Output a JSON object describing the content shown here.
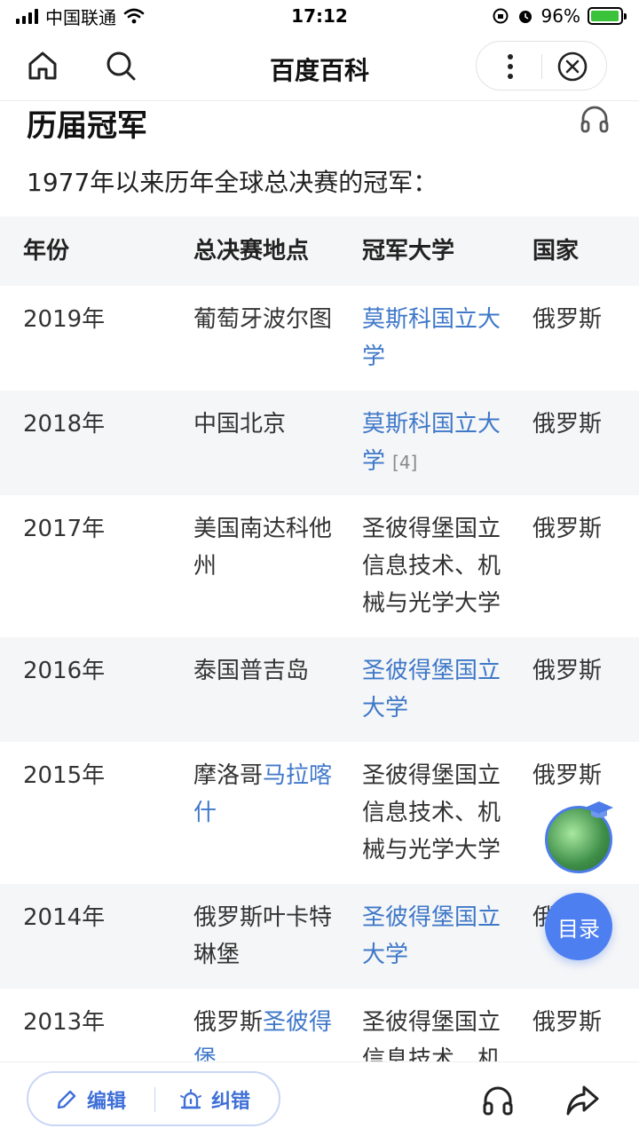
{
  "status_bar": {
    "carrier": "中国联通",
    "time": "17:12",
    "battery": "96%",
    "battery_level": 0.96
  },
  "nav": {
    "title": "百度百科"
  },
  "section": {
    "title": "历届冠军",
    "intro": "1977年以来历年全球总决赛的冠军："
  },
  "table": {
    "headers": [
      "年份",
      "总决赛地点",
      "冠军大学",
      "国家"
    ],
    "rows": [
      {
        "year": "2019年",
        "location": [
          {
            "text": "葡萄牙波尔图",
            "link": false
          }
        ],
        "champion": [
          {
            "text": "莫斯科国立大学",
            "link": true
          }
        ],
        "ref": "",
        "country": "俄罗斯"
      },
      {
        "year": "2018年",
        "location": [
          {
            "text": "中国北京",
            "link": false
          }
        ],
        "champion": [
          {
            "text": "莫斯科国立大学",
            "link": true
          }
        ],
        "ref": "[4]",
        "country": "俄罗斯"
      },
      {
        "year": "2017年",
        "location": [
          {
            "text": "美国南达科他州",
            "link": false
          }
        ],
        "champion": [
          {
            "text": "圣彼得堡国立信息技术、机械与光学大学",
            "link": false
          }
        ],
        "ref": "",
        "country": "俄罗斯"
      },
      {
        "year": "2016年",
        "location": [
          {
            "text": "泰国普吉岛",
            "link": false
          }
        ],
        "champion": [
          {
            "text": "圣彼得堡国立大学",
            "link": true
          }
        ],
        "ref": "",
        "country": "俄罗斯"
      },
      {
        "year": "2015年",
        "location": [
          {
            "text": "摩洛哥",
            "link": false
          },
          {
            "text": "马拉喀什",
            "link": true
          }
        ],
        "champion": [
          {
            "text": "圣彼得堡国立信息技术、机械与光学大学",
            "link": false
          }
        ],
        "ref": "",
        "country": "俄罗斯"
      },
      {
        "year": "2014年",
        "location": [
          {
            "text": "俄罗斯叶卡特琳堡",
            "link": false
          }
        ],
        "champion": [
          {
            "text": "圣彼得堡国立大学",
            "link": true
          }
        ],
        "ref": "",
        "country": "俄罗斯"
      },
      {
        "year": "2013年",
        "location": [
          {
            "text": "俄罗斯",
            "link": false
          },
          {
            "text": "圣彼得堡",
            "link": true
          }
        ],
        "champion": [
          {
            "text": "圣彼得堡国立信息技术、机械与光学大学",
            "link": false
          }
        ],
        "ref": "",
        "country": "俄罗斯"
      }
    ]
  },
  "floating": {
    "toc_label": "目录"
  },
  "bottom_bar": {
    "edit_label": "编辑",
    "fix_label": "纠错"
  },
  "colors": {
    "link": "#3f78c9",
    "accent": "#4e7ff0",
    "row_alt_bg": "#f5f6f7"
  },
  "icons": {
    "home": "home-icon",
    "search": "search-icon",
    "more": "more-vertical-icon",
    "close": "close-circle-icon",
    "headphone": "headphone-icon",
    "edit": "pencil-icon",
    "fix": "alarm-bell-icon",
    "share": "share-arrow-icon",
    "wifi": "wifi-icon",
    "alarm": "alarm-clock-icon",
    "lock": "orientation-lock-icon"
  }
}
